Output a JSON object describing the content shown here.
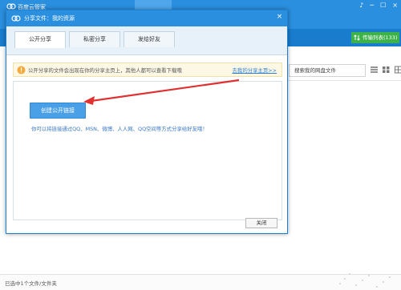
{
  "app": {
    "title": "百度云管家",
    "window_controls": [
      "♪",
      "─",
      "☐",
      "×"
    ],
    "transfer_list_label": "传输列表(133)",
    "search_placeholder": "搜索我的网盘文件",
    "status_text": "已选中1个文件/文件夹"
  },
  "dialog": {
    "title": "分享文件：我的资源",
    "close_glyph": "×",
    "tabs": [
      {
        "label": "公开分享",
        "active": true
      },
      {
        "label": "私密分享",
        "active": false
      },
      {
        "label": "发给好友",
        "active": false
      }
    ],
    "notice_text": "公开分享的文件会出现在你的分享主页上，其他人都可以查看下载哦",
    "notice_link": "去我的分享主页>>",
    "create_link_button": "创建公开链接",
    "description": "你可以将链接通过QQ、MSN、微博、人人网、QQ空间等方式分享给好友哦！",
    "close_button": "关闭"
  },
  "colors": {
    "title_blue": "#2a8fde",
    "button_blue": "#4aa0e6",
    "transfer_green": "#3db24a",
    "arrow_red": "#e03030"
  }
}
